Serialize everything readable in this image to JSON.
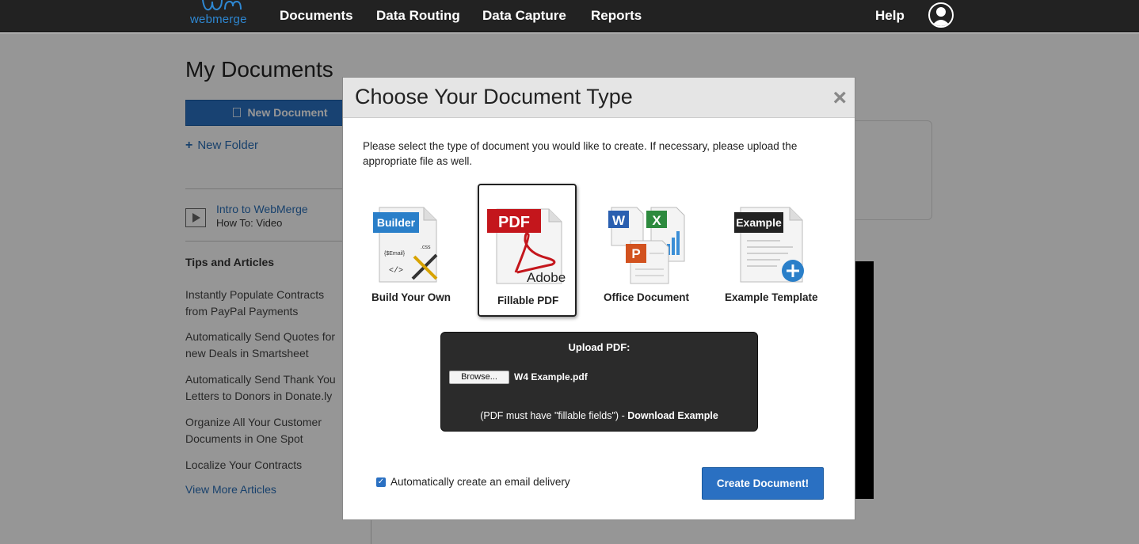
{
  "topbar": {
    "logo_text": "webmerge",
    "nav": [
      "Documents",
      "Data Routing",
      "Data Capture",
      "Reports"
    ],
    "help": "Help",
    "avatar_icon": "user-avatar-icon"
  },
  "sidebar": {
    "page_title": "My Documents",
    "new_document": "New Document",
    "new_folder": "New Folder",
    "intro_link": "Intro to WebMerge",
    "intro_sub": "How To: Video",
    "tips_heading": "Tips and Articles",
    "articles": [
      "Instantly Populate Contracts from PayPal Payments",
      "Automatically Send Quotes for new Deals in Smartsheet",
      "Automatically Send Thank You Letters to Donors in Donate.ly",
      "Organize All Your Customer Documents in One Spot",
      "Localize Your Contracts"
    ],
    "view_more": "View More Articles"
  },
  "modal": {
    "title": "Choose Your Document Type",
    "close_glyph": "×",
    "intro": "Please select the type of document you would like to create. If necessary, please upload the appropriate file as well.",
    "options": [
      {
        "label": "Build Your Own",
        "badge": "Builder",
        "selected": false
      },
      {
        "label": "Fillable PDF",
        "badge": "PDF",
        "brand": "Adobe",
        "selected": true
      },
      {
        "label": "Office Document",
        "selected": false
      },
      {
        "label": "Example Template",
        "badge": "Example",
        "selected": false
      }
    ],
    "builder_icon_text": {
      "email": "{$Email}",
      "css": ".css",
      "code": "</>"
    },
    "upload": {
      "heading": "Upload PDF:",
      "browse": "Browse...",
      "filename": "W4 Example.pdf",
      "note": "(PDF must have \"fillable fields\") - ",
      "note_link": "Download Example"
    },
    "auto_email": {
      "checked": true,
      "label": "Automatically create an email delivery"
    },
    "create_button": "Create Document!"
  },
  "colors": {
    "primary": "#2a70c2",
    "topbar": "#222222",
    "pdf_red": "#c4161c"
  }
}
